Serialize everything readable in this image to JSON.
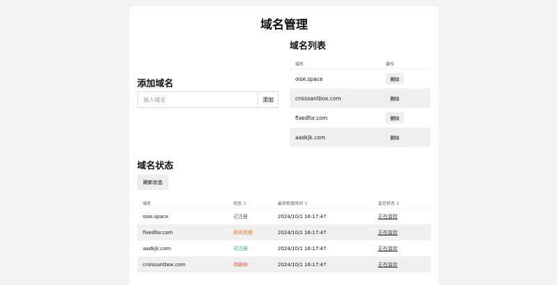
{
  "title": "域名管理",
  "add": {
    "title": "添加域名",
    "placeholder": "输入域名",
    "button": "添加"
  },
  "list": {
    "title": "域名列表",
    "headers": {
      "domain": "域名",
      "action": "操作"
    },
    "rows": [
      {
        "domain": "oise.space",
        "action": "删除"
      },
      {
        "domain": "croissantbox.com",
        "action": "删除"
      },
      {
        "domain": "fixedfor.com",
        "action": "删除"
      },
      {
        "domain": "aadkjk.com",
        "action": "删除"
      }
    ]
  },
  "status": {
    "title": "域名状态",
    "refresh": "刷新状态",
    "headers": {
      "domain": "域名",
      "status": "状态",
      "checked": "最后检查时间",
      "monitor": "监控状态",
      "sort_icon": "↕"
    },
    "rows": [
      {
        "domain": "oise.space",
        "status": "已注册",
        "checked": "2024/10/1 16:17:47",
        "monitor": "正在监控"
      },
      {
        "domain": "fixedfor.com",
        "status": "即将到期",
        "checked": "2024/10/1 16:17:47",
        "monitor": "正在监控"
      },
      {
        "domain": "aadkjk.com",
        "status": "可注册",
        "checked": "2024/10/1 16:17:47",
        "monitor": "正在监控"
      },
      {
        "domain": "croissantbox.com",
        "status": "待删除",
        "checked": "2024/10/1 16:17:47",
        "monitor": "正在监控"
      }
    ]
  },
  "colors": {
    "registered": "#555555",
    "expiring": "#e8782d",
    "available": "#3aa85a",
    "deleting": "#e05a4e"
  }
}
